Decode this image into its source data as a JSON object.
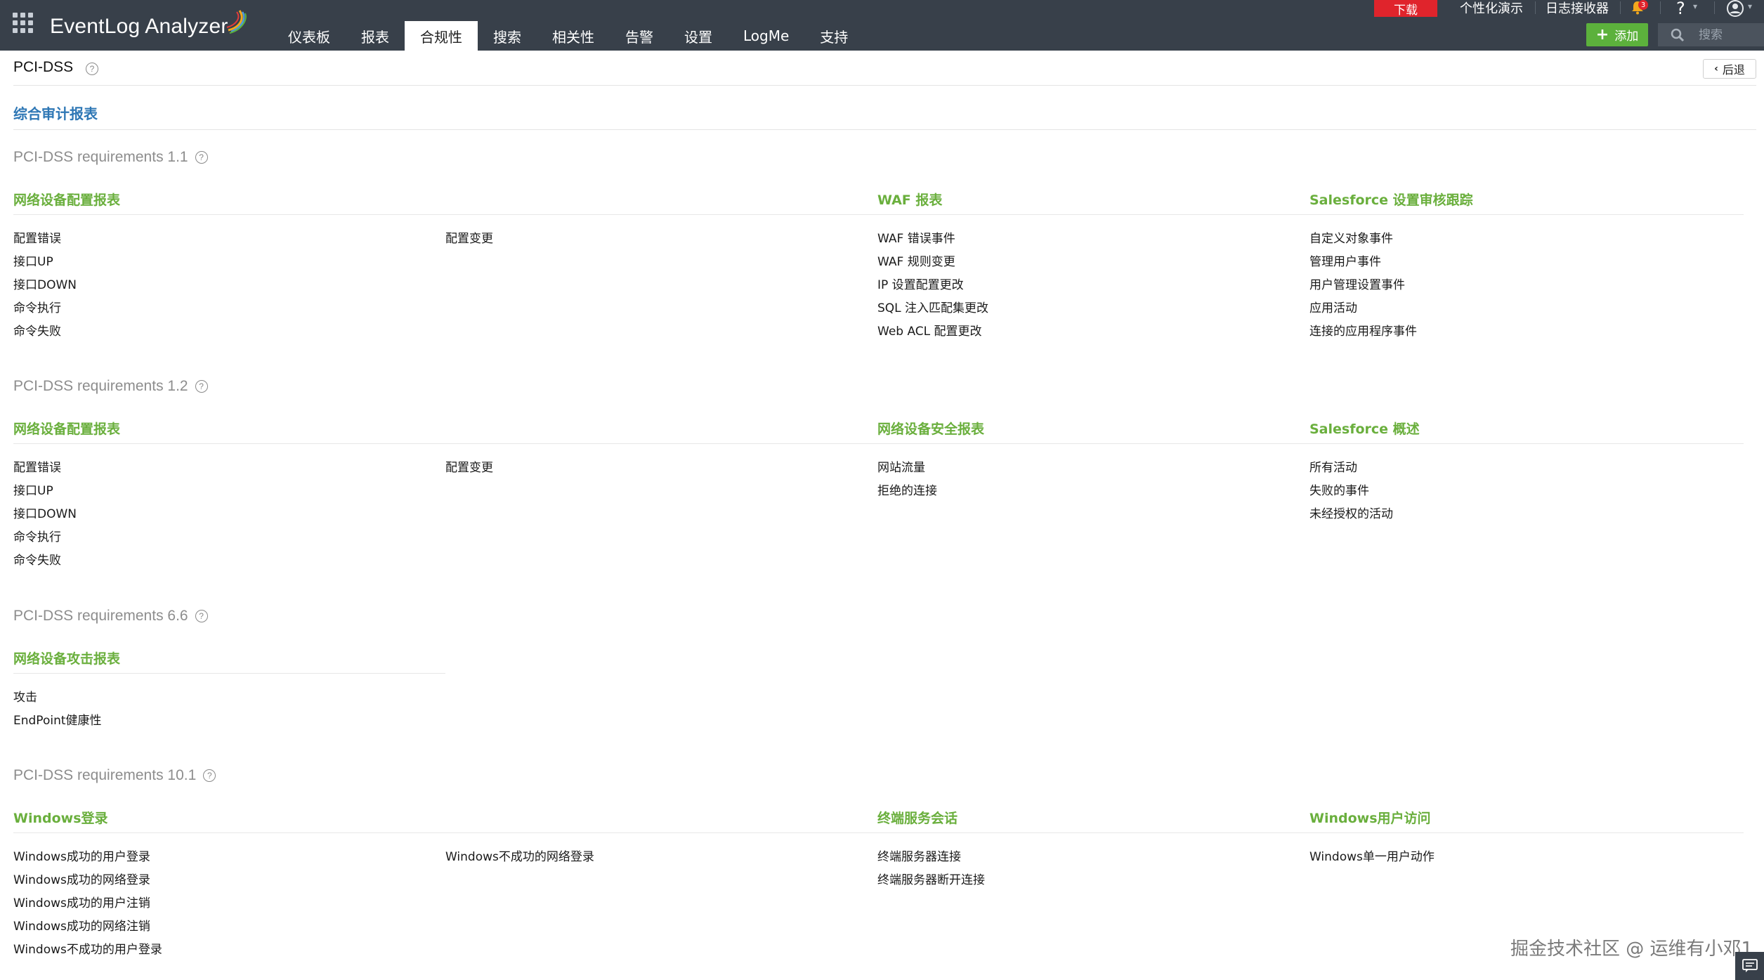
{
  "app": {
    "name": "EventLog Analyzer"
  },
  "nav": {
    "tabs": [
      "仪表板",
      "报表",
      "合规性",
      "搜索",
      "相关性",
      "告警",
      "设置",
      "LogMe",
      "支持"
    ],
    "active_index": 2
  },
  "topbar": {
    "download": "下载",
    "personalize_demo": "个性化演示",
    "log_receiver": "日志接收器",
    "notification_count": "3",
    "help": "?",
    "add_label": "添加",
    "search_placeholder": "搜索"
  },
  "page": {
    "title": "PCI-DSS",
    "back_label": "后退",
    "summary_link": "综合审计报表"
  },
  "requirements": [
    {
      "title": "PCI-DSS requirements 1.1",
      "groups": [
        {
          "title": "网络设备配置报表",
          "items": [
            "配置错误",
            "接口UP",
            "接口DOWN",
            "命令执行",
            "命令失败"
          ],
          "items_col2": [
            "配置变更"
          ]
        },
        {
          "title": "WAF 报表",
          "items": [
            "WAF 错误事件",
            "WAF 规则变更",
            "IP 设置配置更改",
            "SQL 注入匹配集更改",
            "Web ACL 配置更改"
          ]
        },
        {
          "title": "Salesforce 设置审核跟踪",
          "items": [
            "自定义对象事件",
            "管理用户事件",
            "用户管理设置事件",
            "应用活动",
            "连接的应用程序事件"
          ]
        }
      ]
    },
    {
      "title": "PCI-DSS requirements 1.2",
      "groups": [
        {
          "title": "网络设备配置报表",
          "items": [
            "配置错误",
            "接口UP",
            "接口DOWN",
            "命令执行",
            "命令失败"
          ],
          "items_col2": [
            "配置变更"
          ]
        },
        {
          "title": "网络设备安全报表",
          "items": [
            "网站流量",
            "拒绝的连接"
          ]
        },
        {
          "title": "Salesforce 概述",
          "items": [
            "所有活动",
            "失败的事件",
            "未经授权的活动"
          ]
        }
      ]
    },
    {
      "title": "PCI-DSS requirements 6.6",
      "groups": [
        {
          "title": "网络设备攻击报表",
          "items": [
            "攻击",
            "EndPoint健康性"
          ]
        }
      ]
    },
    {
      "title": "PCI-DSS requirements 10.1",
      "groups": [
        {
          "title": "Windows登录",
          "items": [
            "Windows成功的用户登录",
            "Windows成功的网络登录",
            "Windows成功的用户注销",
            "Windows成功的网络注销",
            "Windows不成功的用户登录"
          ],
          "items_col2": [
            "Windows不成功的网络登录"
          ]
        },
        {
          "title": "终端服务会话",
          "items": [
            "终端服务器连接",
            "终端服务器断开连接"
          ]
        },
        {
          "title": "Windows用户访问",
          "items": [
            "Windows单一用户动作"
          ]
        }
      ]
    }
  ],
  "watermark": "掘金技术社区 @ 运维有小邓1"
}
